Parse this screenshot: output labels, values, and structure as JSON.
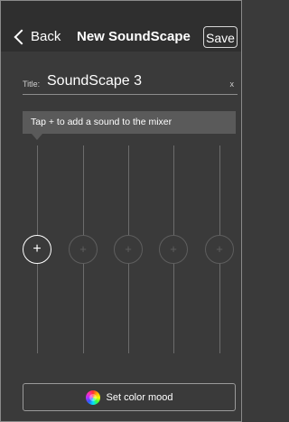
{
  "navbar": {
    "back_label": "Back",
    "title": "New SoundScape",
    "save_label": "Save"
  },
  "title_field": {
    "label": "Title:",
    "value": "SoundScape 3",
    "clear_label": "x"
  },
  "hint": {
    "text": "Tap + to add a sound to the mixer"
  },
  "sliders": [
    {
      "knob": "+",
      "active": true
    },
    {
      "knob": "+",
      "active": false
    },
    {
      "knob": "+",
      "active": false
    },
    {
      "knob": "+",
      "active": false
    },
    {
      "knob": "+",
      "active": false
    }
  ],
  "mood_button": {
    "icon": "color-wheel-icon",
    "label": "Set color mood"
  },
  "colors": {
    "background": "#3a3a3a",
    "navbar": "#2f2f2f",
    "hint_bg": "#5a5a5a",
    "text": "#ffffff"
  }
}
